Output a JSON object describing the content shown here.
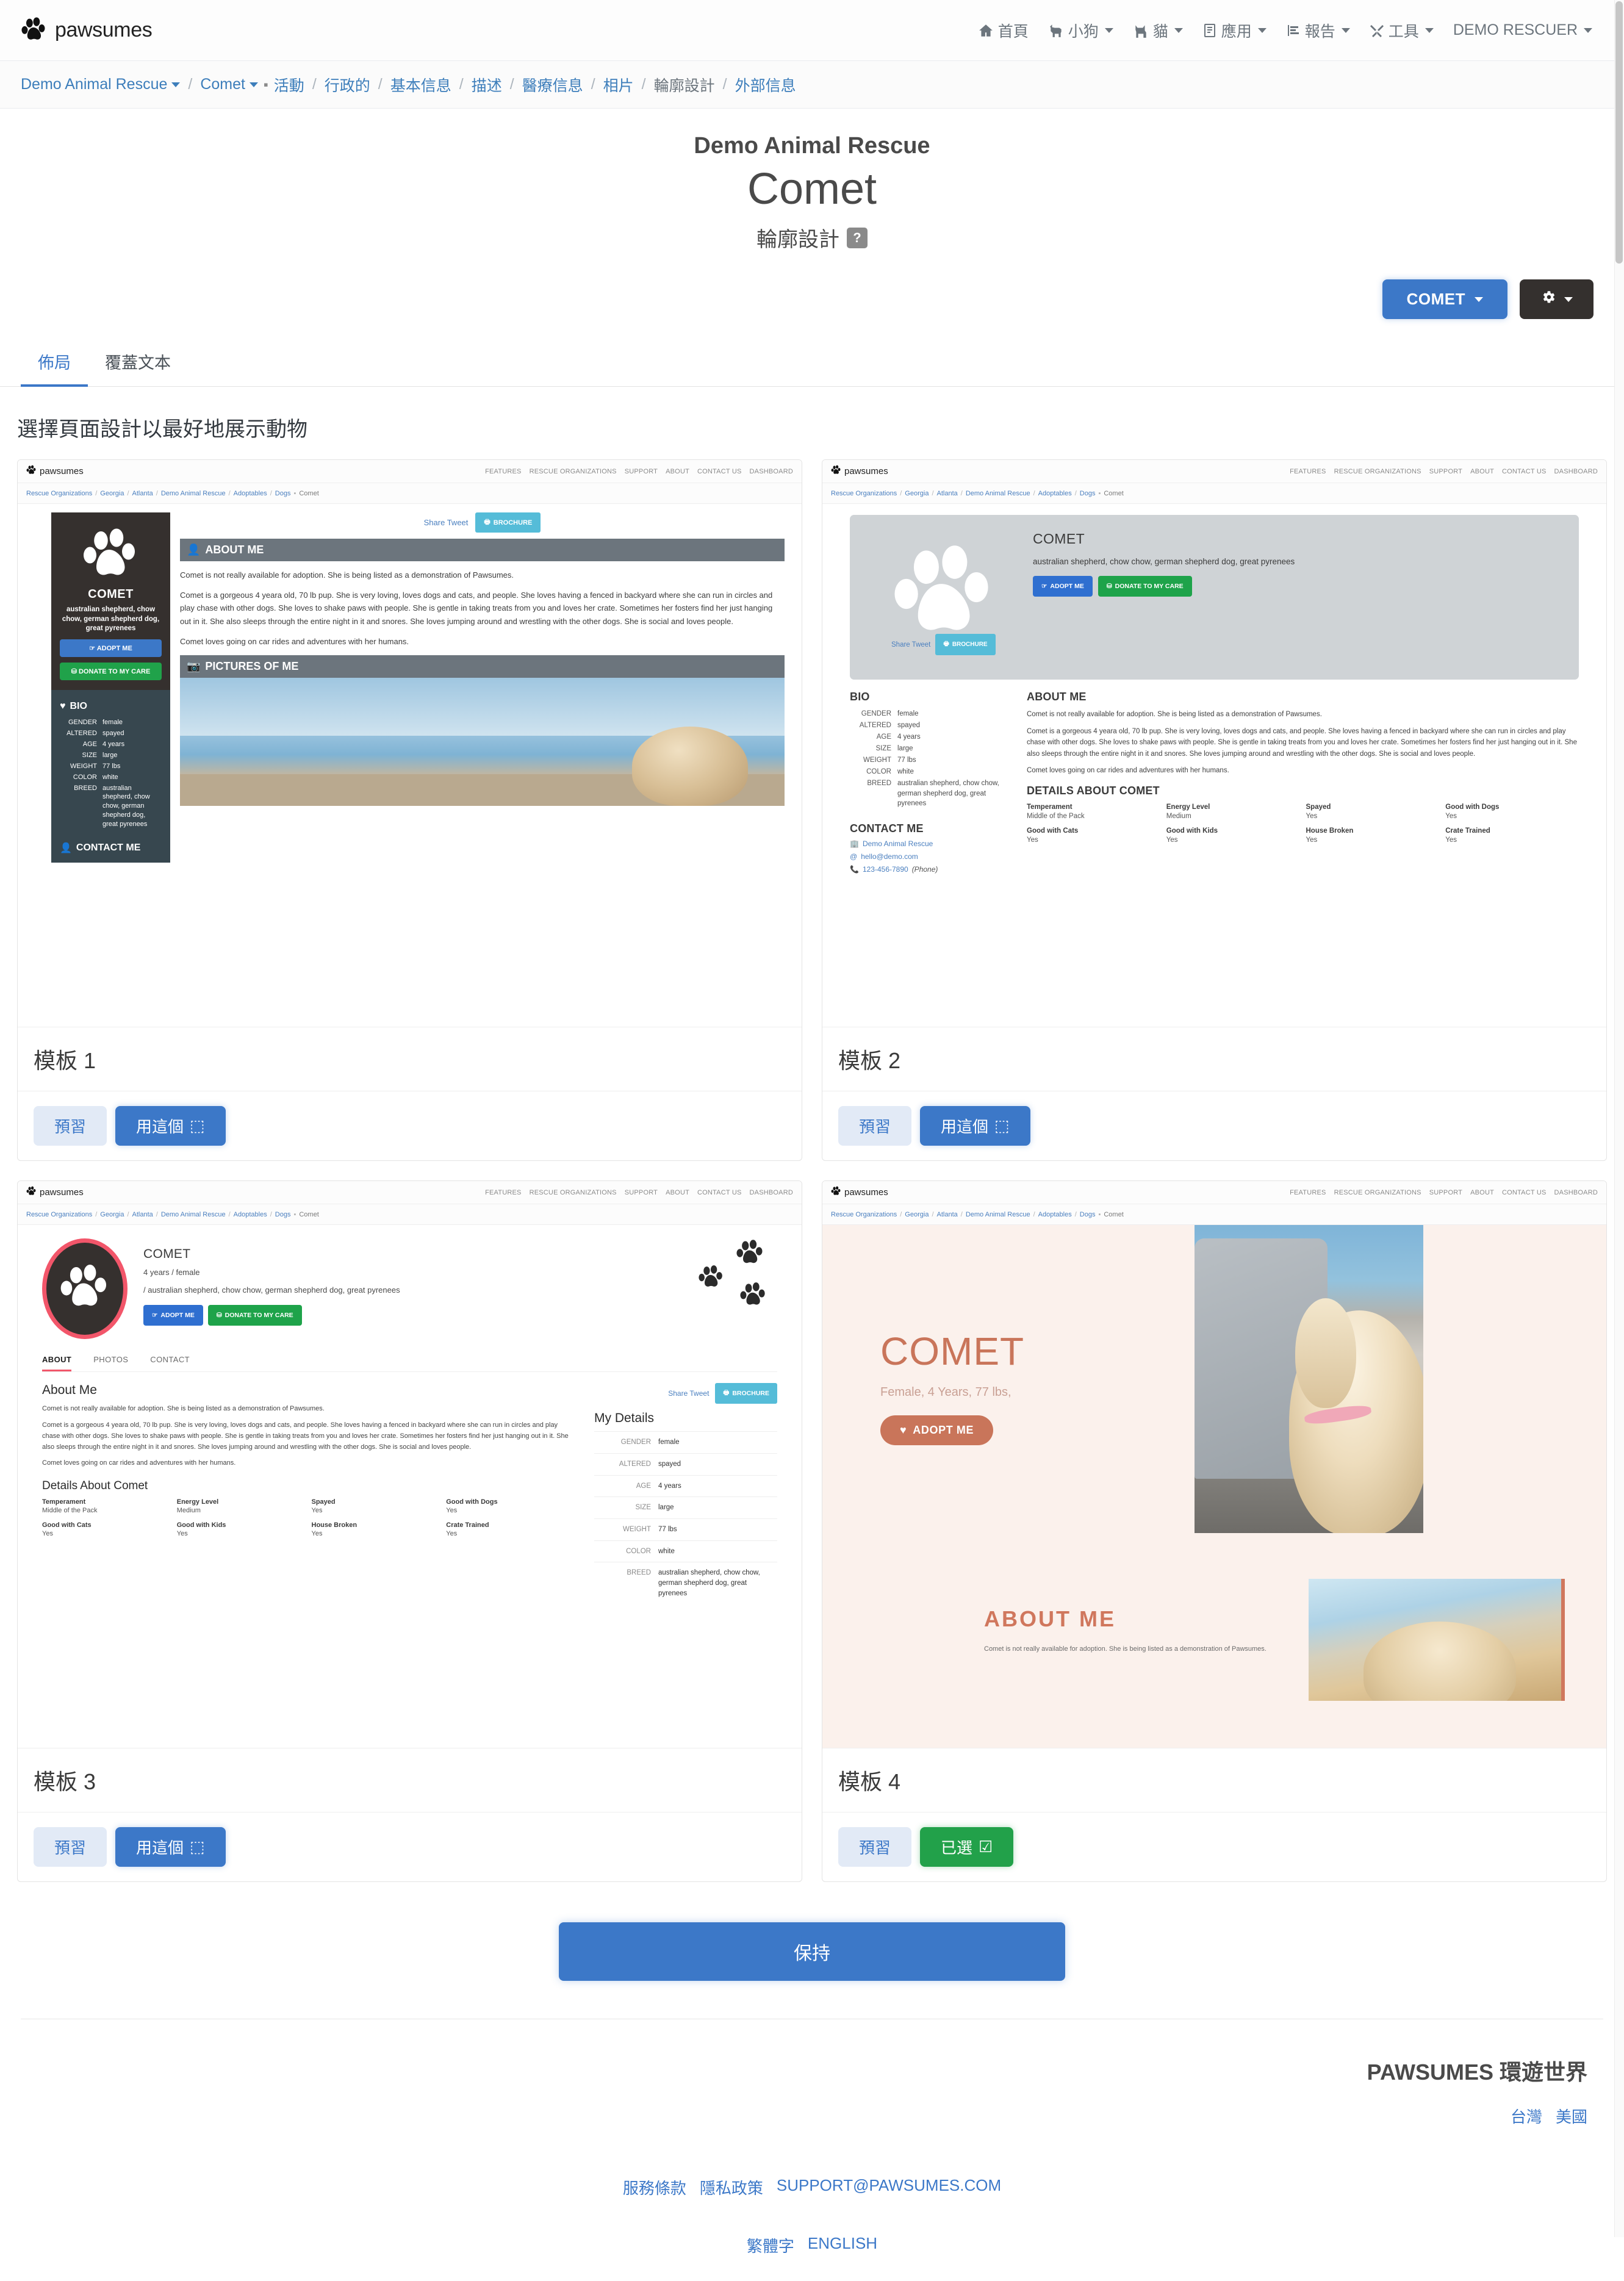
{
  "navbar": {
    "brand": "pawsumes",
    "items": [
      {
        "label": "首頁",
        "icon": "home-icon",
        "caret": false
      },
      {
        "label": "小狗",
        "icon": "dog-icon",
        "caret": true
      },
      {
        "label": "貓",
        "icon": "cat-icon",
        "caret": true
      },
      {
        "label": "應用",
        "icon": "application-icon",
        "caret": true
      },
      {
        "label": "報告",
        "icon": "report-icon",
        "caret": true
      },
      {
        "label": "工具",
        "icon": "tools-icon",
        "caret": true
      },
      {
        "label": "DEMO RESCUER",
        "icon": "",
        "caret": true
      }
    ]
  },
  "breadcrumb": {
    "org": "Demo Animal Rescue",
    "animal": "Comet",
    "links": [
      "活動",
      "行政的",
      "基本信息",
      "描述",
      "醫療信息",
      "相片",
      "輪廓設計",
      "外部信息"
    ],
    "current_index": 6
  },
  "page": {
    "org_name": "Demo Animal Rescue",
    "animal_name": "Comet",
    "subtitle": "輪廓設計",
    "help_badge": "?"
  },
  "actions": {
    "comet_button": "COMET",
    "gear_button": "gear-icon"
  },
  "tabs": [
    {
      "label": "佈局",
      "active": true
    },
    {
      "label": "覆蓋文本",
      "active": false
    }
  ],
  "section_title": "選擇頁面設計以最好地展示動物",
  "template_buttons": {
    "preview": "預習",
    "use_this": "用這個",
    "selected": "已選"
  },
  "templates": [
    {
      "caption": "模板 1",
      "selected": false
    },
    {
      "caption": "模板 2",
      "selected": false
    },
    {
      "caption": "模板 3",
      "selected": false
    },
    {
      "caption": "模板 4",
      "selected": true
    }
  ],
  "save_button": "保持",
  "mini_site": {
    "brand": "pawsumes",
    "nav_links": [
      "FEATURES",
      "RESCUE ORGANIZATIONS",
      "SUPPORT",
      "ABOUT",
      "CONTACT US",
      "DASHBOARD"
    ],
    "crumbs": [
      "Rescue Organizations",
      "Georgia",
      "Atlanta",
      "Demo Animal Rescue",
      "Adoptables",
      "Dogs"
    ],
    "crumb_current": "Comet"
  },
  "animal": {
    "name_upper": "COMET",
    "breed": "australian shepherd, chow chow, german shepherd dog, great pyrenees",
    "breed_short": "australian shepherd, chow chow, german shepherd dog, great pyrenees",
    "age": "4 years",
    "gender": "female",
    "altered": "spayed",
    "size": "large",
    "weight": "77 lbs",
    "color": "white",
    "meta_line_t3": "4 years / female",
    "meta_line_t3b": "/ australian shepherd, chow chow, german shepherd dog, great pyrenees",
    "meta_line_t4": "Female, 4 Years, 77 lbs,",
    "adopt_me": "ADOPT ME",
    "donate": "DONATE TO MY CARE",
    "share_tweet": "Share Tweet",
    "brochure": "BROCHURE",
    "about_heading": "ABOUT ME",
    "about_heading_title": "About Me",
    "pictures_heading": "PICTURES OF ME",
    "bio_heading": "BIO",
    "my_details_heading": "My Details",
    "contact_heading": "CONTACT ME",
    "details_heading": "DETAILS ABOUT COMET",
    "details_heading_title": "Details About Comet",
    "bio_labels": [
      "GENDER",
      "ALTERED",
      "AGE",
      "SIZE",
      "WEIGHT",
      "COLOR",
      "BREED"
    ],
    "bio_values": [
      "female",
      "spayed",
      "4 years",
      "large",
      "77 lbs",
      "white",
      "australian shepherd, chow chow, german shepherd dog, great pyrenees"
    ],
    "about_p1": "Comet is not really available for adoption. She is being listed as a demonstration of Pawsumes.",
    "about_p2": "Comet is a gorgeous 4 yeara old, 70 lb pup. She is very loving, loves dogs and cats, and people. She loves having a fenced in backyard where she can run in circles and play chase with other dogs. She loves to shake paws with people. She is gentle in taking treats from you and loves her crate. Sometimes her fosters find her just hanging out in it. She also sleeps through the entire night in it and snores. She loves jumping around and wrestling with the other dogs. She is social and loves people.",
    "about_p3": "Comet loves going on car rides and adventures with her humans.",
    "contact": {
      "org": "Demo Animal Rescue",
      "email": "hello@demo.com",
      "phone": "123-456-7890",
      "phone_type": "(Phone)"
    },
    "detail_pairs": [
      {
        "label": "Temperament",
        "value": "Middle of the Pack"
      },
      {
        "label": "Energy Level",
        "value": "Medium"
      },
      {
        "label": "Spayed",
        "value": "Yes"
      },
      {
        "label": "Good with Dogs",
        "value": "Yes"
      },
      {
        "label": "Good with Cats",
        "value": "Yes"
      },
      {
        "label": "Good with Kids",
        "value": "Yes"
      },
      {
        "label": "House Broken",
        "value": "Yes"
      },
      {
        "label": "Crate Trained",
        "value": "Yes"
      }
    ],
    "t3_tabs": [
      "ABOUT",
      "PHOTOS",
      "CONTACT"
    ]
  },
  "footer": {
    "title": "PAWSUMES 環遊世界",
    "countries": [
      "台灣",
      "美國"
    ],
    "links": [
      "服務條款",
      "隱私政策",
      "SUPPORT@PAWSUMES.COM"
    ],
    "languages": [
      "繁體字",
      "ENGLISH"
    ]
  },
  "colors": {
    "primary": "#3c78c8",
    "success": "#22a14a",
    "info": "#55bcd8",
    "dark": "#35302e",
    "accent_t3": "#f2566a",
    "accent_t4": "#c9755a"
  }
}
